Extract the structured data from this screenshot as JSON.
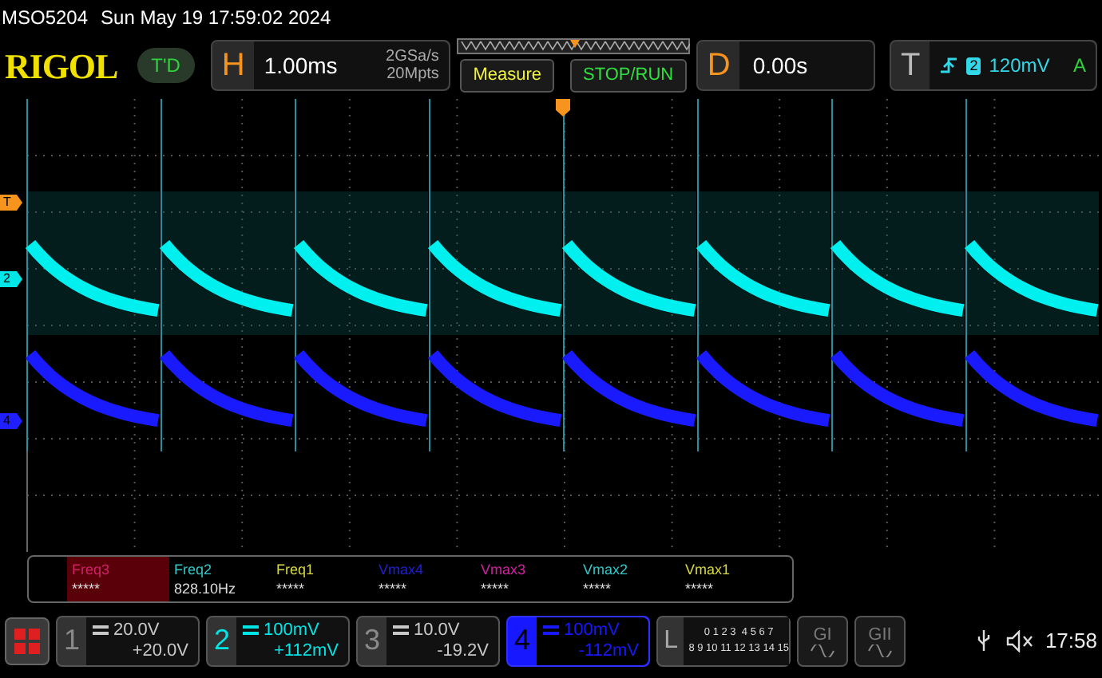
{
  "status_line": {
    "model": "MSO5204",
    "datetime": "Sun May 19 17:59:02 2024"
  },
  "toolbar": {
    "logo": "RIGOL",
    "badge": "T'D",
    "horizontal": {
      "label": "H",
      "timebase": "1.00ms",
      "sample_rate": "2GSa/s",
      "memory_depth": "20Mpts"
    },
    "buttons": [
      {
        "label": "Measure",
        "kind": "measure"
      },
      {
        "label": "STOP/RUN",
        "kind": "run"
      }
    ],
    "delay": {
      "label": "D",
      "value": "0.00s"
    },
    "trigger": {
      "label": "T",
      "source": "2",
      "level": "120mV",
      "mode": "A"
    }
  },
  "markers": [
    {
      "label": "T",
      "color": "#f7941d"
    },
    {
      "label": "2",
      "color": "#00e5e5"
    },
    {
      "label": "4",
      "color": "#2020ff"
    }
  ],
  "measurements": [
    {
      "label": "Freq3",
      "value": "*****",
      "color": "#d0206a",
      "selected": true
    },
    {
      "label": "Freq2",
      "value": "828.10Hz",
      "color": "#30c8c8",
      "selected": false
    },
    {
      "label": "Freq1",
      "value": "*****",
      "color": "#d8d840",
      "selected": false
    },
    {
      "label": "Vmax4",
      "value": "*****",
      "color": "#2020d0",
      "selected": false
    },
    {
      "label": "Vmax3",
      "value": "*****",
      "color": "#d020a0",
      "selected": false
    },
    {
      "label": "Vmax2",
      "value": "*****",
      "color": "#30c8c8",
      "selected": false
    },
    {
      "label": "Vmax1",
      "value": "*****",
      "color": "#d8d840",
      "selected": false
    }
  ],
  "channels": [
    {
      "number": "1",
      "scale": "20.0V",
      "offset": "+20.0V",
      "color": "#c8c8c8",
      "enabled": false,
      "selected": false
    },
    {
      "number": "2",
      "scale": "100mV",
      "offset": "+112mV",
      "color": "#00e5e5",
      "enabled": true,
      "selected": false
    },
    {
      "number": "3",
      "scale": "10.0V",
      "offset": "-19.2V",
      "color": "#c8c8c8",
      "enabled": false,
      "selected": false
    },
    {
      "number": "4",
      "scale": "100mV",
      "offset": "-112mV",
      "color": "#1818ff",
      "enabled": true,
      "selected": true
    }
  ],
  "logic": {
    "label": "L",
    "rows": [
      "0 1 2 3  4 5 6 7",
      "8 9 10 11 12 13 14 15"
    ]
  },
  "generators": [
    "GI",
    "GII"
  ],
  "clock": "17:58"
}
